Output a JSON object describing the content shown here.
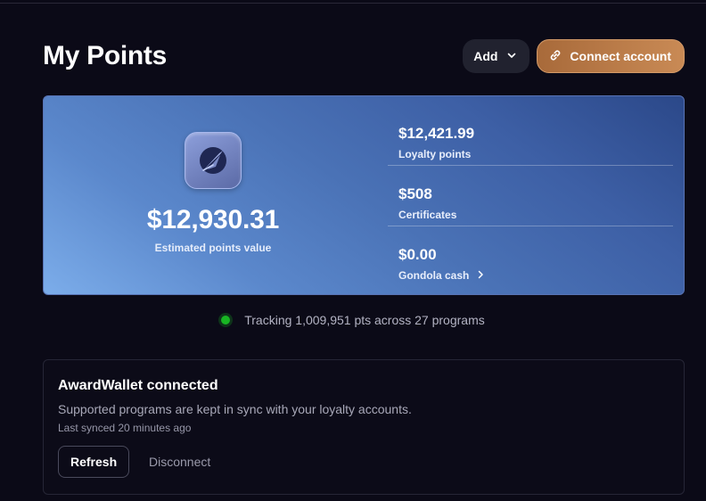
{
  "header": {
    "title": "My Points",
    "add_label": "Add",
    "connect_label": "Connect account"
  },
  "summary": {
    "total_value": "$12,930.31",
    "total_label": "Estimated points value",
    "stats": [
      {
        "value": "$12,421.99",
        "label": "Loyalty points"
      },
      {
        "value": "$508",
        "label": "Certificates"
      },
      {
        "value": "$0.00",
        "label": "Gondola cash"
      }
    ]
  },
  "tracking": {
    "text": "Tracking 1,009,951 pts across 27 programs",
    "status_color": "#18b523"
  },
  "awardwallet": {
    "title": "AwardWallet connected",
    "description": "Supported programs are kept in sync with your loyalty accounts.",
    "last_synced": "Last synced 20 minutes ago",
    "refresh_label": "Refresh",
    "disconnect_label": "Disconnect"
  },
  "icons": {
    "add_chevron": "chevron-down-icon",
    "connect": "link-icon",
    "logo": "gondola-logo-icon",
    "gondola_cash": "chevron-right-icon"
  },
  "colors": {
    "background": "#0b0a17",
    "accent_copper": "#c98a55",
    "card_gradient_start": "#7cadea",
    "card_gradient_end": "#2b4889"
  }
}
